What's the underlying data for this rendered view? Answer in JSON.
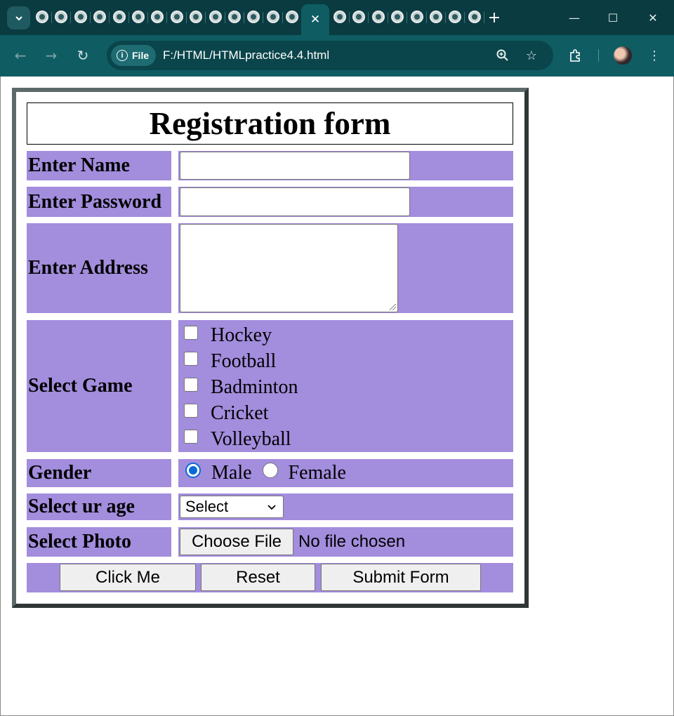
{
  "browser": {
    "tab_count_left": 14,
    "tab_count_right": 8,
    "active_tab_close": "✕",
    "new_tab": "+",
    "window_controls": {
      "minimize": "—",
      "maximize": "☐",
      "close": "✕"
    },
    "address_chip": "File",
    "url": "F:/HTML/HTMLpractice4.4.html",
    "icons": [
      "tab-search-icon",
      "back-icon",
      "forward-icon",
      "reload-icon",
      "info-icon",
      "zoom-icon",
      "star-icon",
      "extensions-icon",
      "avatar",
      "menu-icon"
    ]
  },
  "form": {
    "title": "Registration form",
    "colors": {
      "cell": "#a38ddd",
      "border": "#2f3636",
      "radio_accent": "#0a6ad8"
    },
    "labels": {
      "name": "Enter Name",
      "password": "Enter Password",
      "address": "Enter Address",
      "game": "Select Game",
      "gender": "Gender",
      "age": "Select ur age",
      "photo": "Select Photo"
    },
    "name_value": "",
    "password_value": "",
    "address_value": "",
    "games": [
      {
        "label": "Hockey",
        "checked": false
      },
      {
        "label": "Football",
        "checked": false
      },
      {
        "label": "Badminton",
        "checked": false
      },
      {
        "label": "Cricket",
        "checked": false
      },
      {
        "label": "Volleyball",
        "checked": false
      }
    ],
    "gender": {
      "options": [
        "Male",
        "Female"
      ],
      "selected": "Male"
    },
    "age_select": {
      "value": "Select"
    },
    "file": {
      "button": "Choose File",
      "status": "No file chosen"
    },
    "buttons": {
      "click_me": "Click Me",
      "reset": "Reset",
      "submit": "Submit Form"
    }
  }
}
